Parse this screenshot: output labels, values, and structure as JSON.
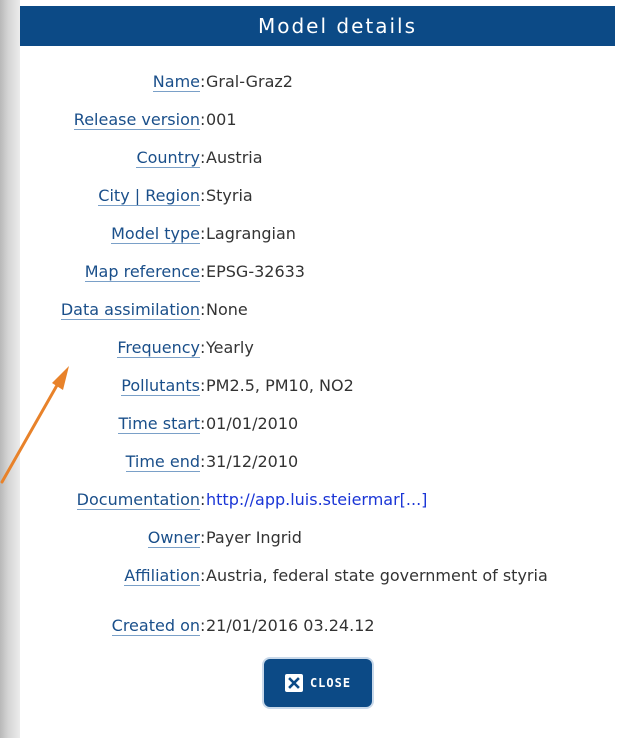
{
  "dialog": {
    "title": "Model details",
    "close_label": "CLOSE"
  },
  "details": [
    {
      "label": "Name",
      "value": "Gral-Graz2"
    },
    {
      "label": "Release version",
      "value": "001"
    },
    {
      "label": "Country",
      "value": "Austria"
    },
    {
      "label": "City | Region",
      "value": "Styria"
    },
    {
      "label": "Model type",
      "value": "Lagrangian"
    },
    {
      "label": "Map reference",
      "value": "EPSG-32633"
    },
    {
      "label": "Data assimilation",
      "value": "None"
    },
    {
      "label": "Frequency",
      "value": "Yearly"
    },
    {
      "label": "Pollutants",
      "value": "PM2.5, PM10, NO2"
    },
    {
      "label": "Time start",
      "value": "01/01/2010"
    },
    {
      "label": "Time end",
      "value": "31/12/2010"
    },
    {
      "label": "Documentation",
      "value": "http://app.luis.steiermar[...]"
    },
    {
      "label": "Owner",
      "value": "Payer Ingrid"
    },
    {
      "label": "Affiliation",
      "value": "Austria, federal state government of styria"
    },
    {
      "label": "Created on",
      "value": "21/01/2016 03.24.12"
    }
  ],
  "colors": {
    "titlebar": "#0c4a86",
    "label": "#1a4f8a",
    "link": "#1a35d6",
    "annotation_arrow": "#e8822a"
  },
  "icons": {
    "close": "close-x-icon",
    "annotation": "orange-arrow-icon"
  }
}
